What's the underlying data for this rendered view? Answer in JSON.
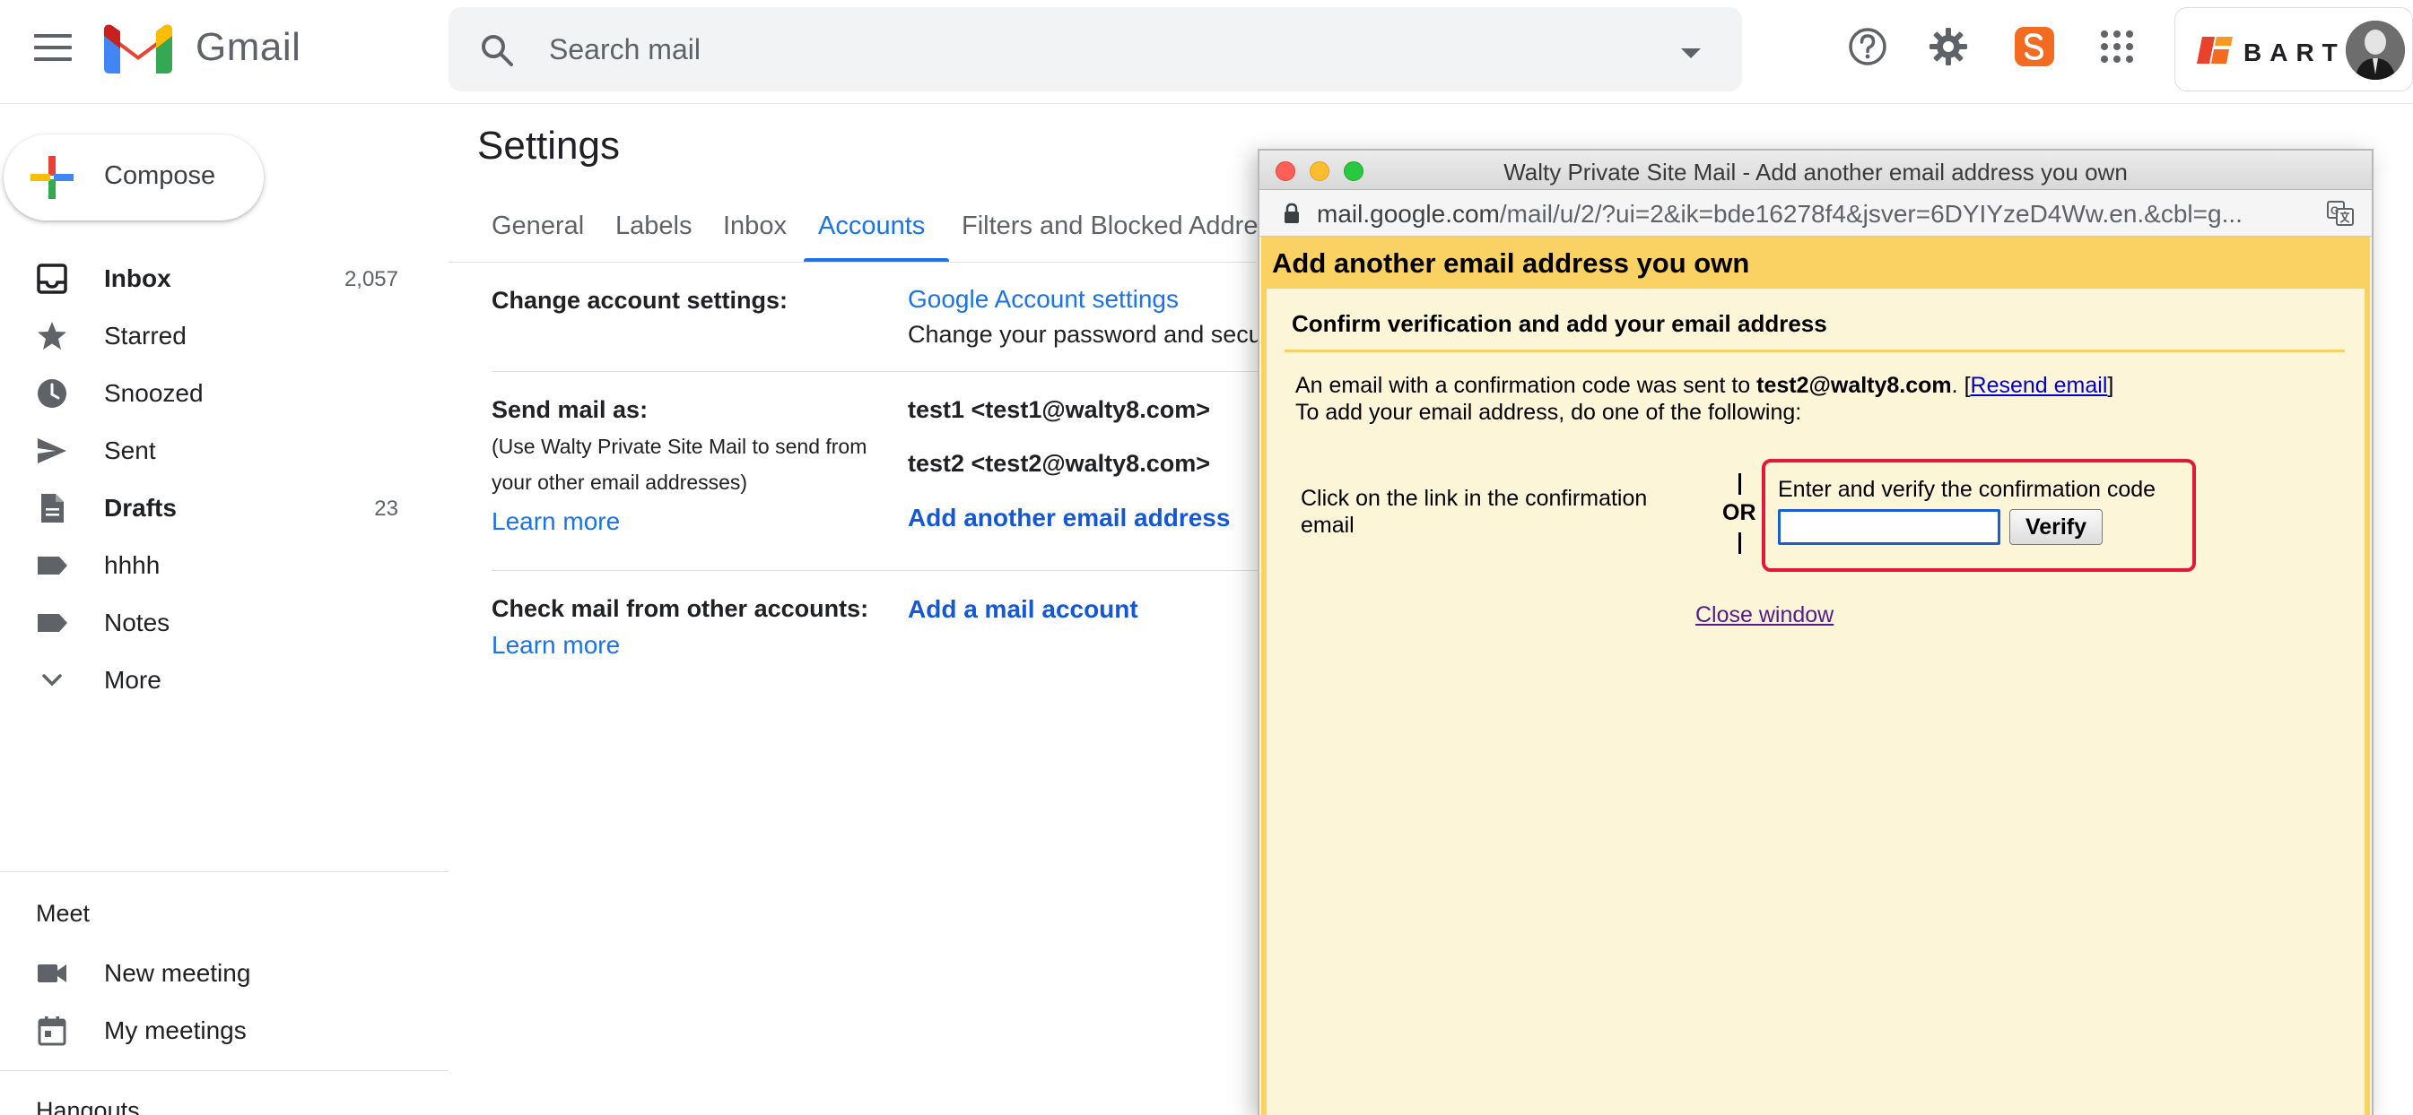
{
  "app": {
    "logo_text": "Gmail"
  },
  "search": {
    "placeholder": "Search mail"
  },
  "account": {
    "brand_text": "BART"
  },
  "compose": {
    "label": "Compose"
  },
  "sidebar": {
    "items": [
      {
        "label": "Inbox",
        "count": "2,057",
        "bold": true
      },
      {
        "label": "Starred",
        "count": ""
      },
      {
        "label": "Snoozed",
        "count": ""
      },
      {
        "label": "Sent",
        "count": ""
      },
      {
        "label": "Drafts",
        "count": "23",
        "bold": true
      },
      {
        "label": "hhhh",
        "count": ""
      },
      {
        "label": "Notes",
        "count": ""
      },
      {
        "label": "More",
        "count": ""
      }
    ],
    "meet": {
      "title": "Meet",
      "new_meeting": "New meeting",
      "my_meetings": "My meetings"
    },
    "hangouts_title": "Hangouts"
  },
  "settings": {
    "title": "Settings",
    "tabs": [
      "General",
      "Labels",
      "Inbox",
      "Accounts",
      "Filters and Blocked Addresses"
    ],
    "active_tab": "Accounts",
    "change_account": {
      "label": "Change account settings:",
      "link": "Google Account settings",
      "description": "Change your password and security options"
    },
    "send_mail_as": {
      "label": "Send mail as:",
      "sub_line1": "(Use Walty Private Site Mail to send from",
      "sub_line2": "your other email addresses)",
      "learn_more": "Learn more",
      "addresses": [
        "test1 <test1@walty8.com>",
        "test2 <test2@walty8.com>"
      ],
      "add_link": "Add another email address"
    },
    "check_mail": {
      "label": "Check mail from other accounts:",
      "learn_more": "Learn more",
      "add_link": "Add a mail account"
    }
  },
  "popup": {
    "window_title": "Walty Private Site Mail - Add another email address you own",
    "url_host": "mail.google.com",
    "url_path": "/mail/u/2/?ui=2&ik=bde16278f4&jsver=6DYIYzeD4Ww.en.&cbl=g...",
    "header": "Add another email address you own",
    "subheader": "Confirm verification and add your email address",
    "sent_prefix": "An email with a confirmation code was sent to ",
    "sent_email": "test2@walty8.com",
    "sent_suffix": ". [",
    "resend_link": "Resend email",
    "sent_close": "]",
    "instruction": "To add your email address, do one of the following:",
    "option1_line1": "Click on the link in the confirmation",
    "option1_line2": "email",
    "or_text": "OR",
    "option2_label": "Enter and verify the confirmation code",
    "code_value": "",
    "verify_label": "Verify",
    "close_link": "Close window"
  },
  "colors": {
    "accent": "#1a73e8",
    "popup_header": "#fad163",
    "popup_bg": "#fdf5d8",
    "highlight": "#e0193a"
  }
}
